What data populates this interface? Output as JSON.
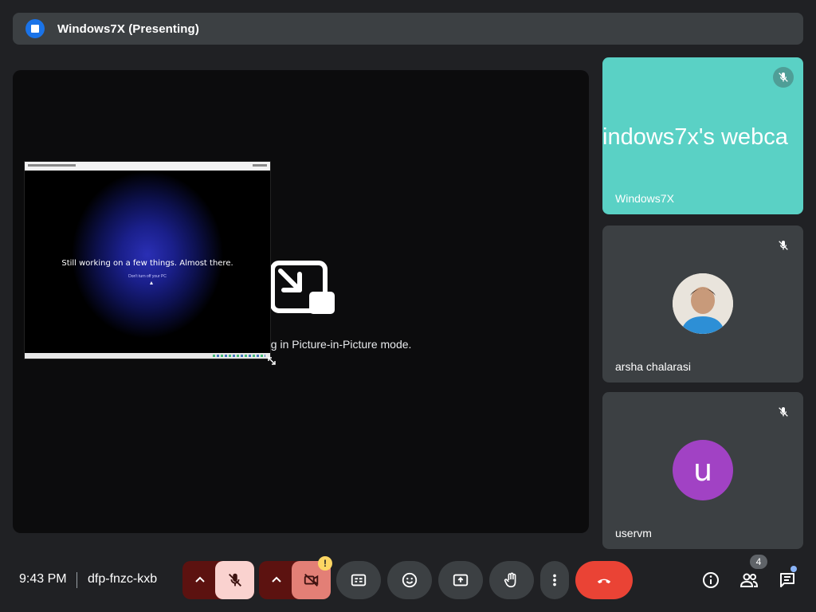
{
  "presenting_bar": {
    "title": "Windows7X (Presenting)",
    "icon": "present-screen-icon",
    "accent": "#1a73e8"
  },
  "stage": {
    "pip_message": "ng in Picture-in-Picture mode.",
    "pip_window": {
      "screen_message": "Still working on a few things. Almost there.",
      "screen_subtext": "Don't turn off your PC"
    }
  },
  "participants": [
    {
      "name": "Windows7X",
      "webcam_text": "indows7x's webca",
      "muted": true,
      "background": "#5ad1c5"
    },
    {
      "name": "arsha chalarasi",
      "muted": true,
      "avatar": "photo"
    },
    {
      "name": "uservm",
      "muted": true,
      "avatar_letter": "u",
      "avatar_color": "#a142c4"
    }
  ],
  "bottom_bar": {
    "time": "9:43 PM",
    "meeting_code": "dfp-fnzc-kxb",
    "warning_badge": "!",
    "people_count": "4",
    "controls": [
      "mic-off",
      "camera-off",
      "captions",
      "emoji-reactions",
      "present-now",
      "raise-hand",
      "more-options",
      "leave-call"
    ],
    "leave_color": "#ea4335"
  }
}
